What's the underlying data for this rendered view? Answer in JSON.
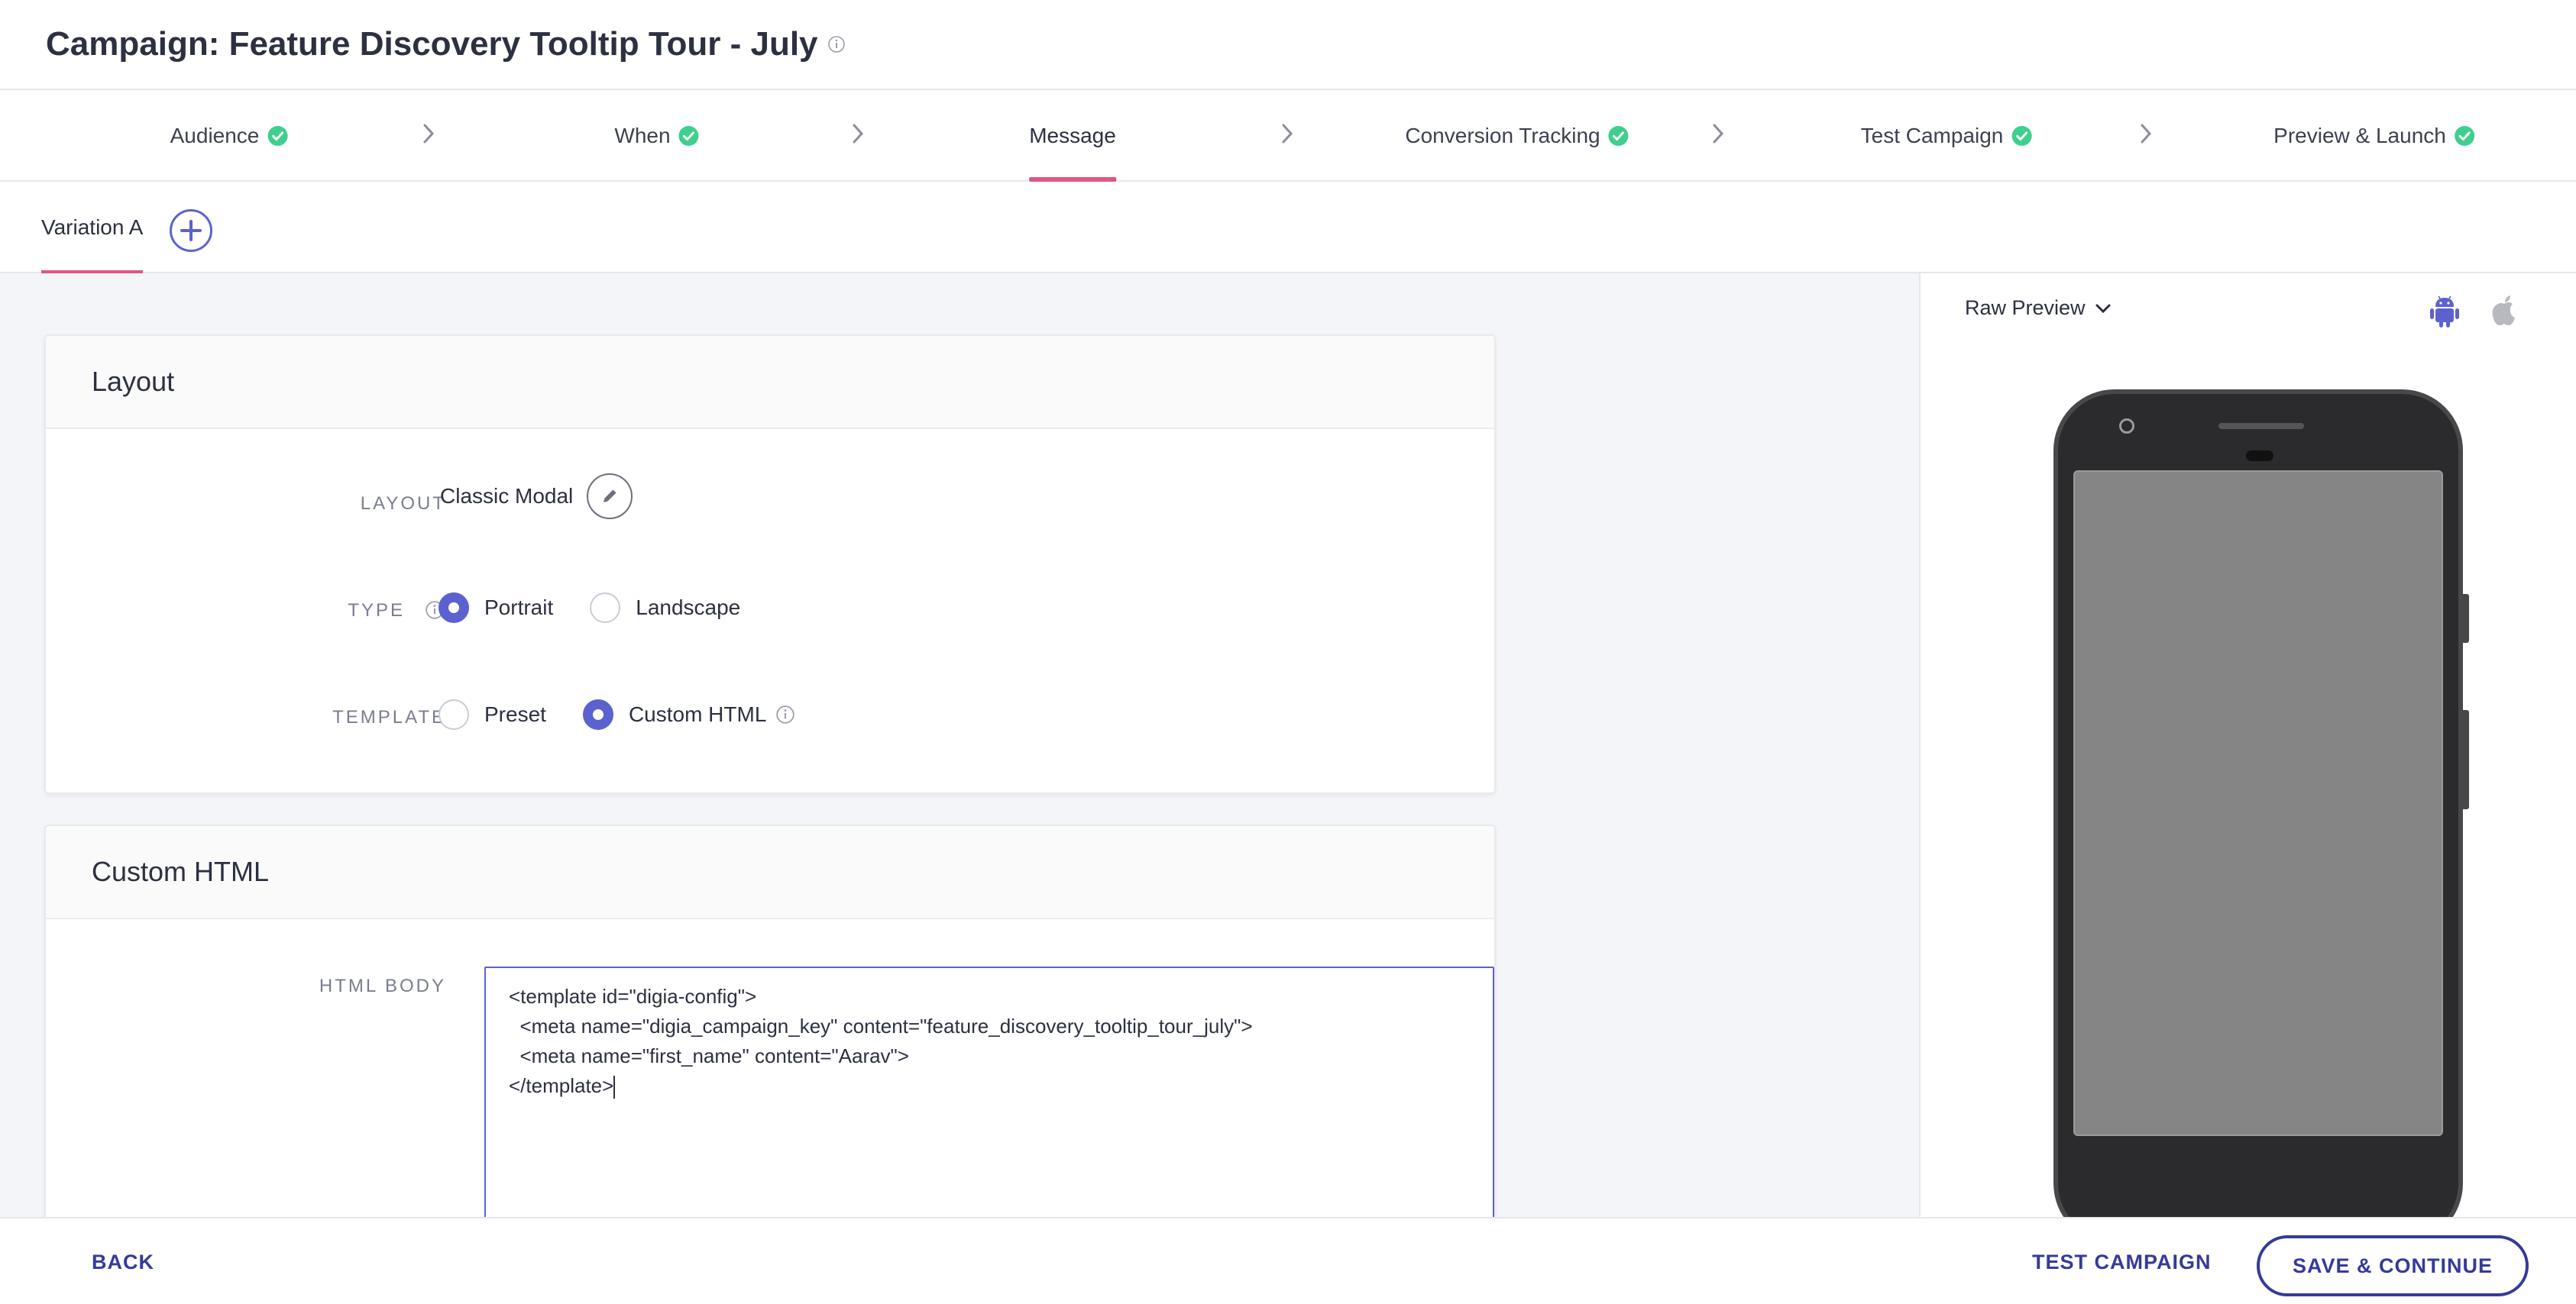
{
  "header": {
    "title": "Campaign: Feature Discovery Tooltip Tour - July"
  },
  "steps": [
    {
      "label": "Audience",
      "done": true
    },
    {
      "label": "When",
      "done": true
    },
    {
      "label": "Message",
      "done": false,
      "active": true
    },
    {
      "label": "Conversion Tracking",
      "done": true
    },
    {
      "label": "Test Campaign",
      "done": true
    },
    {
      "label": "Preview & Launch",
      "done": true
    }
  ],
  "variations": {
    "active_tab": "Variation A"
  },
  "layout_card": {
    "title": "Layout",
    "layout_label": "LAYOUT",
    "layout_value": "Classic Modal",
    "type_label": "TYPE",
    "type_options": [
      "Portrait",
      "Landscape"
    ],
    "type_selected": "Portrait",
    "template_label": "TEMPLATE",
    "template_options": [
      "Preset",
      "Custom HTML"
    ],
    "template_selected": "Custom HTML"
  },
  "custom_html_card": {
    "title": "Custom HTML",
    "body_label": "HTML BODY",
    "code_lines": [
      "<template id=\"digia-config\">",
      "  <meta name=\"digia_campaign_key\" content=\"feature_discovery_tooltip_tour_july\">",
      "  <meta name=\"first_name\" content=\"Aarav\">",
      "</template>"
    ]
  },
  "preview": {
    "mode": "Raw Preview",
    "platforms": [
      "android-icon",
      "apple-icon"
    ],
    "selected_platform": "android"
  },
  "footer": {
    "back": "BACK",
    "test_campaign": "TEST CAMPAIGN",
    "save_continue": "SAVE & CONTINUE"
  },
  "colors": {
    "accent": "#5b62cf",
    "tab_underline": "#e0567f",
    "success": "#3ecf8e",
    "button_text": "#353a9a"
  }
}
